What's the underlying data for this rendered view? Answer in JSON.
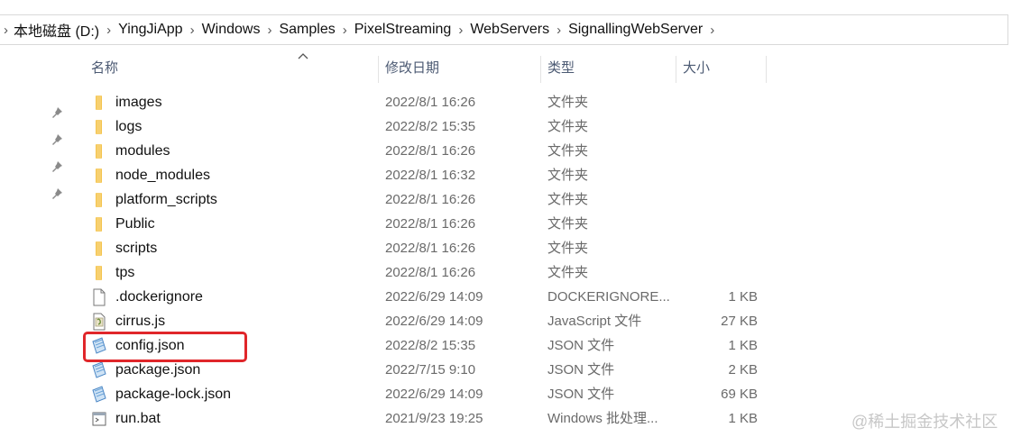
{
  "breadcrumb": [
    "本地磁盘 (D:)",
    "YingJiApp",
    "Windows",
    "Samples",
    "PixelStreaming",
    "WebServers",
    "SignallingWebServer"
  ],
  "columns": {
    "name": "名称",
    "date": "修改日期",
    "type": "类型",
    "size": "大小"
  },
  "files": [
    {
      "name": "images",
      "date": "2022/8/1 16:26",
      "type": "文件夹",
      "size": "",
      "icon": "folder-icon"
    },
    {
      "name": "logs",
      "date": "2022/8/2 15:35",
      "type": "文件夹",
      "size": "",
      "icon": "folder-icon"
    },
    {
      "name": "modules",
      "date": "2022/8/1 16:26",
      "type": "文件夹",
      "size": "",
      "icon": "folder-icon"
    },
    {
      "name": "node_modules",
      "date": "2022/8/1 16:32",
      "type": "文件夹",
      "size": "",
      "icon": "folder-icon"
    },
    {
      "name": "platform_scripts",
      "date": "2022/8/1 16:26",
      "type": "文件夹",
      "size": "",
      "icon": "folder-icon"
    },
    {
      "name": "Public",
      "date": "2022/8/1 16:26",
      "type": "文件夹",
      "size": "",
      "icon": "folder-icon"
    },
    {
      "name": "scripts",
      "date": "2022/8/1 16:26",
      "type": "文件夹",
      "size": "",
      "icon": "folder-icon"
    },
    {
      "name": "tps",
      "date": "2022/8/1 16:26",
      "type": "文件夹",
      "size": "",
      "icon": "folder-icon"
    },
    {
      "name": ".dockerignore",
      "date": "2022/6/29 14:09",
      "type": "DOCKERIGNORE...",
      "size": "1 KB",
      "icon": "blank-file-icon"
    },
    {
      "name": "cirrus.js",
      "date": "2022/6/29 14:09",
      "type": "JavaScript 文件",
      "size": "27 KB",
      "icon": "script-file-icon"
    },
    {
      "name": "config.json",
      "date": "2022/8/2 15:35",
      "type": "JSON 文件",
      "size": "1 KB",
      "icon": "json-file-icon"
    },
    {
      "name": "package.json",
      "date": "2022/7/15 9:10",
      "type": "JSON 文件",
      "size": "2 KB",
      "icon": "json-file-icon"
    },
    {
      "name": "package-lock.json",
      "date": "2022/6/29 14:09",
      "type": "JSON 文件",
      "size": "69 KB",
      "icon": "json-file-icon"
    },
    {
      "name": "run.bat",
      "date": "2021/9/23 19:25",
      "type": "Windows 批处理...",
      "size": "1 KB",
      "icon": "batch-file-icon"
    }
  ],
  "highlighted_file": "config.json",
  "highlight_color": "#e0262a",
  "watermark": "@稀土掘金技术社区",
  "colors": {
    "folder": "#f2c14b",
    "header_text": "#4c5a73"
  }
}
